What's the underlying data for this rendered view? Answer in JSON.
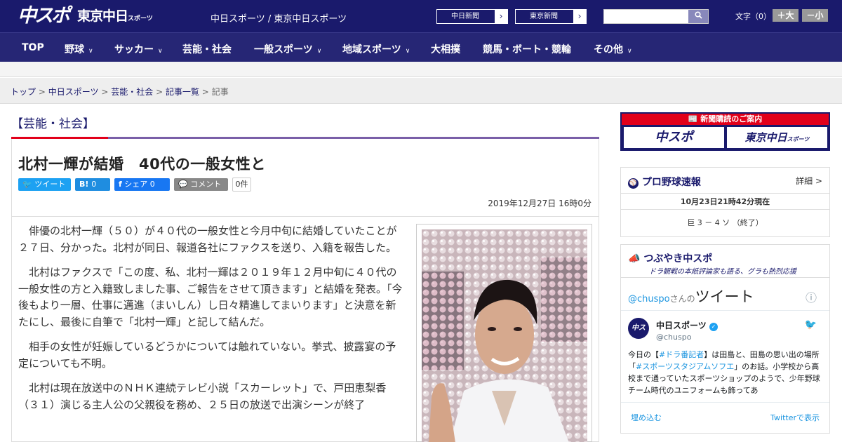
{
  "header": {
    "logo_main": "中スポ",
    "logo_sub": "東京中日",
    "logo_sub_small": "スポーツ",
    "site_name": "中日スポーツ / 東京中日スポーツ",
    "paper_links": [
      "中日新聞",
      "東京新聞"
    ],
    "arrow_icon": "›",
    "search_placeholder": "",
    "search_icon": "🔍",
    "font_size_label": "文字（0）",
    "font_plus": "＋大",
    "font_minus": "－小"
  },
  "nav": {
    "items": [
      {
        "label": "TOP",
        "chev": ""
      },
      {
        "label": "野球",
        "chev": "∨"
      },
      {
        "label": "サッカー",
        "chev": "∨"
      },
      {
        "label": "芸能・社会",
        "chev": ""
      },
      {
        "label": "一般スポーツ",
        "chev": "∨"
      },
      {
        "label": "地域スポーツ",
        "chev": "∨"
      },
      {
        "label": "大相撲",
        "chev": ""
      },
      {
        "label": "競馬・ボート・競輪",
        "chev": ""
      },
      {
        "label": "その他",
        "chev": "∨"
      }
    ]
  },
  "breadcrumb": {
    "items": [
      "トップ",
      "中日スポーツ",
      "芸能・社会",
      "記事一覧"
    ],
    "current": "記事",
    "sep": ">"
  },
  "article": {
    "category": "【芸能・社会】",
    "title": "北村一輝が結婚　40代の一般女性と",
    "share": {
      "tweet": "ツイート",
      "hatena": "B!",
      "hatena_count": "0",
      "facebook": "シェア",
      "facebook_count": "0",
      "comment": "コメント",
      "comment_count": "0件"
    },
    "date": "2019年12月27日 16時0分",
    "paragraphs": [
      "俳優の北村一輝（５０）が４０代の一般女性と今月中旬に結婚していたことが２７日、分かった。北村が同日、報道各社にファクスを送り、入籍を報告した。",
      "北村はファクスで「この度、私、北村一輝は２０１９年１２月中旬に４０代の一般女性の方と入籍致しました事、ご報告をさせて頂きます」と結婚を発表。「今後もより一層、仕事に邁進（まいしん）し日々精進してまいります」と決意を新たにし、最後に自筆で「北村一輝」と記して結んだ。",
      "相手の女性が妊娠しているどうかについては触れていない。挙式、披露宴の予定についても不明。",
      "北村は現在放送中のＮＨＫ連続テレビ小説「スカーレット」で、戸田恵梨香（３１）演じる主人公の父親役を務め、２５日の放送で出演シーンが終了"
    ]
  },
  "sidebar": {
    "newspaper": {
      "header": "新聞購読のご案内",
      "left": "中スポ",
      "right": "東京中日",
      "right_small": "スポーツ"
    },
    "baseball": {
      "title": "プロ野球速報",
      "detail": "詳細 >",
      "updated": "10月23日21時42分現在",
      "score": "巨 3 － 4 ソ （終了）"
    },
    "tweets": {
      "title": "つぶやき中スポ",
      "subtitle": "ドラ観戦の本紙評論家も語る、グラも熱烈応援",
      "handle_prefix": "@chuspo",
      "handle_suffix": "さんの",
      "tweet_word": "ツイート",
      "info": "ⓘ",
      "user_name": "中日スポーツ",
      "user_handle": "@chuspo",
      "tweet_text_1": "今日の【",
      "tweet_tag_1": "#ドラ番記者",
      "tweet_text_2": "】は田島と、田島の思い出の場所「",
      "tweet_tag_2": "#スポーツスタジアムソフエ",
      "tweet_text_3": "」のお話。小学校から高校まで通っていたスポーツショップのようで、少年野球チーム時代のユニフォームも飾ってあ",
      "embed": "埋め込む",
      "view_on_twitter": "Twitterで表示"
    }
  }
}
